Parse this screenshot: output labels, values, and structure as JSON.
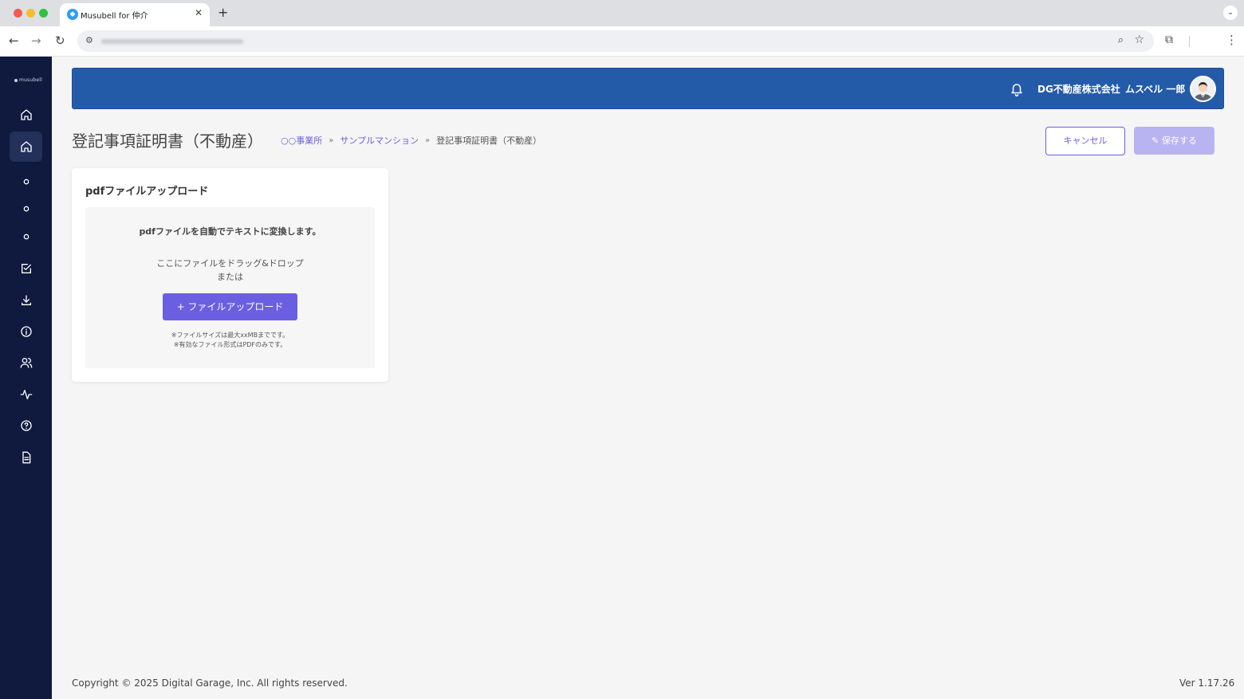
{
  "browser": {
    "tab_title": "Musubell for 仲介",
    "favicon_char": "◆",
    "close_glyph": "✕",
    "new_tab_glyph": "+",
    "tab_menu_glyph": "⌄"
  },
  "toolbar": {
    "back": "←",
    "forward": "→",
    "reload": "↻",
    "site_info": "⚙",
    "zoom": "⌕",
    "star": "☆",
    "extensions": "⧉",
    "menu": "⋮"
  },
  "sidebar": {
    "logo_text": "musubell",
    "items": [
      {
        "name": "home",
        "active": false
      },
      {
        "name": "home-active",
        "active": true
      },
      {
        "name": "circle-1",
        "active": false
      },
      {
        "name": "circle-2",
        "active": false
      },
      {
        "name": "circle-3",
        "active": false
      },
      {
        "name": "checklist",
        "active": false
      },
      {
        "name": "download",
        "active": false
      },
      {
        "name": "info",
        "active": false
      },
      {
        "name": "users",
        "active": false
      },
      {
        "name": "activity",
        "active": false
      },
      {
        "name": "help",
        "active": false
      },
      {
        "name": "document",
        "active": false
      }
    ]
  },
  "header": {
    "company": "DG不動産株式会社",
    "user_name": "ムスベル 一郎"
  },
  "page": {
    "title": "登記事項証明書（不動産）",
    "breadcrumb": {
      "office": "○○事業所",
      "sep1": "»",
      "property": "サンプルマンション",
      "sep2": "»",
      "current": "登記事項証明書（不動産）"
    },
    "cancel_label": "キャンセル",
    "save_label": "保存する",
    "save_icon": "✎"
  },
  "upload_card": {
    "title": "pdfファイルアップロード",
    "heading": "pdfファイルを自動でテキストに変換します。",
    "drag_text": "ここにファイルをドラッグ&ドロップ",
    "or_text": "または",
    "button_label": "+ ファイルアップロード",
    "note_size": "※ファイルサイズは最大xxMBまでです。",
    "note_format": "※有効なファイル形式はPDFのみです。"
  },
  "footer": {
    "copyright": "Copyright © 2025 Digital Garage, Inc. All rights reserved.",
    "version": "Ver 1.17.26"
  },
  "colors": {
    "sidebar_bg": "#101a3e",
    "header_bg": "#235ba9",
    "accent": "#6a5fe0",
    "save_disabled": "#b8b4f1"
  }
}
